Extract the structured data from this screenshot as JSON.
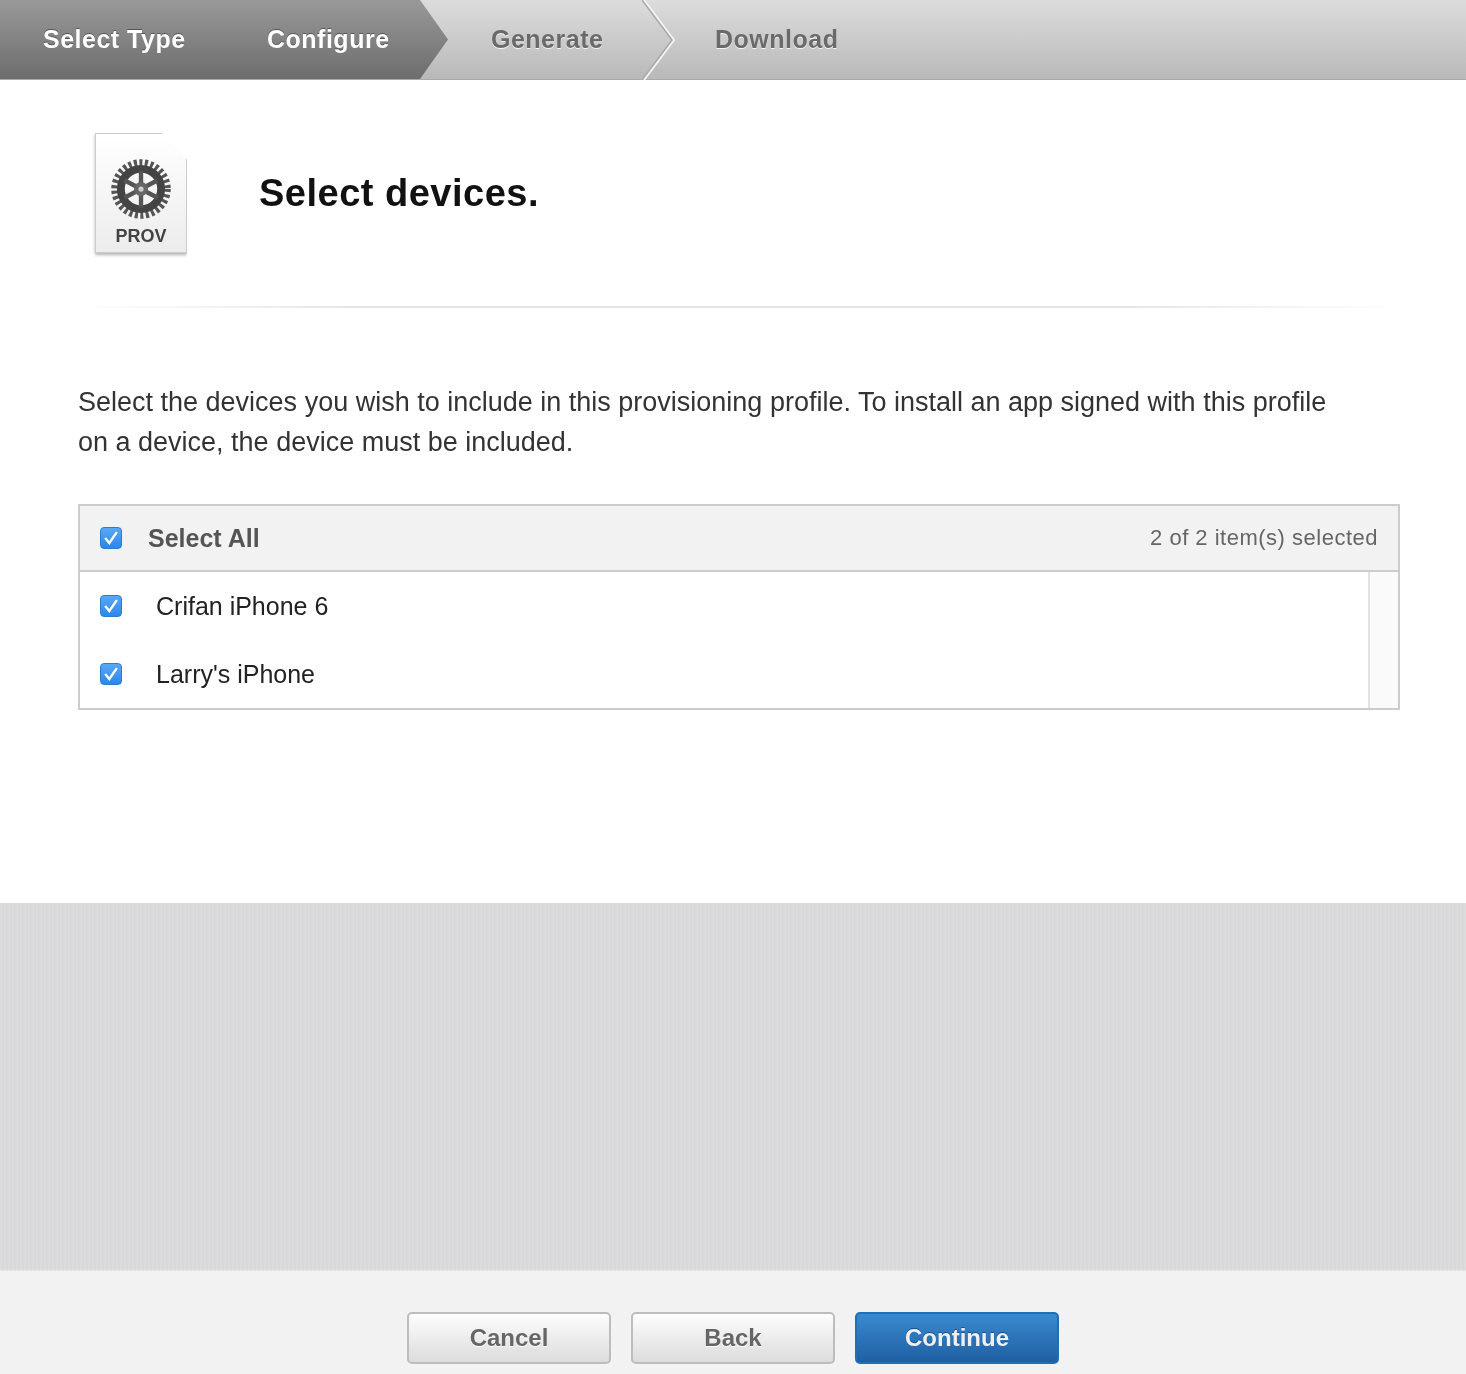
{
  "steps": [
    {
      "label": "Select Type",
      "active": true
    },
    {
      "label": "Configure",
      "active": true
    },
    {
      "label": "Generate",
      "active": false
    },
    {
      "label": "Download",
      "active": false
    }
  ],
  "file_icon": {
    "label": "PROV"
  },
  "title": "Select devices.",
  "description": "Select the devices you wish to include in this provisioning profile. To install an app signed with this profile on a device, the device must be included.",
  "device_list": {
    "select_all": {
      "label": "Select All",
      "checked": true
    },
    "count": "2 of 2 item(s) selected",
    "devices": [
      {
        "name": "Crifan iPhone 6",
        "checked": true
      },
      {
        "name": "Larry's iPhone",
        "checked": true
      }
    ]
  },
  "buttons": [
    {
      "label": "Cancel",
      "kind": "default"
    },
    {
      "label": "Back",
      "kind": "default"
    },
    {
      "label": "Continue",
      "kind": "primary"
    }
  ]
}
